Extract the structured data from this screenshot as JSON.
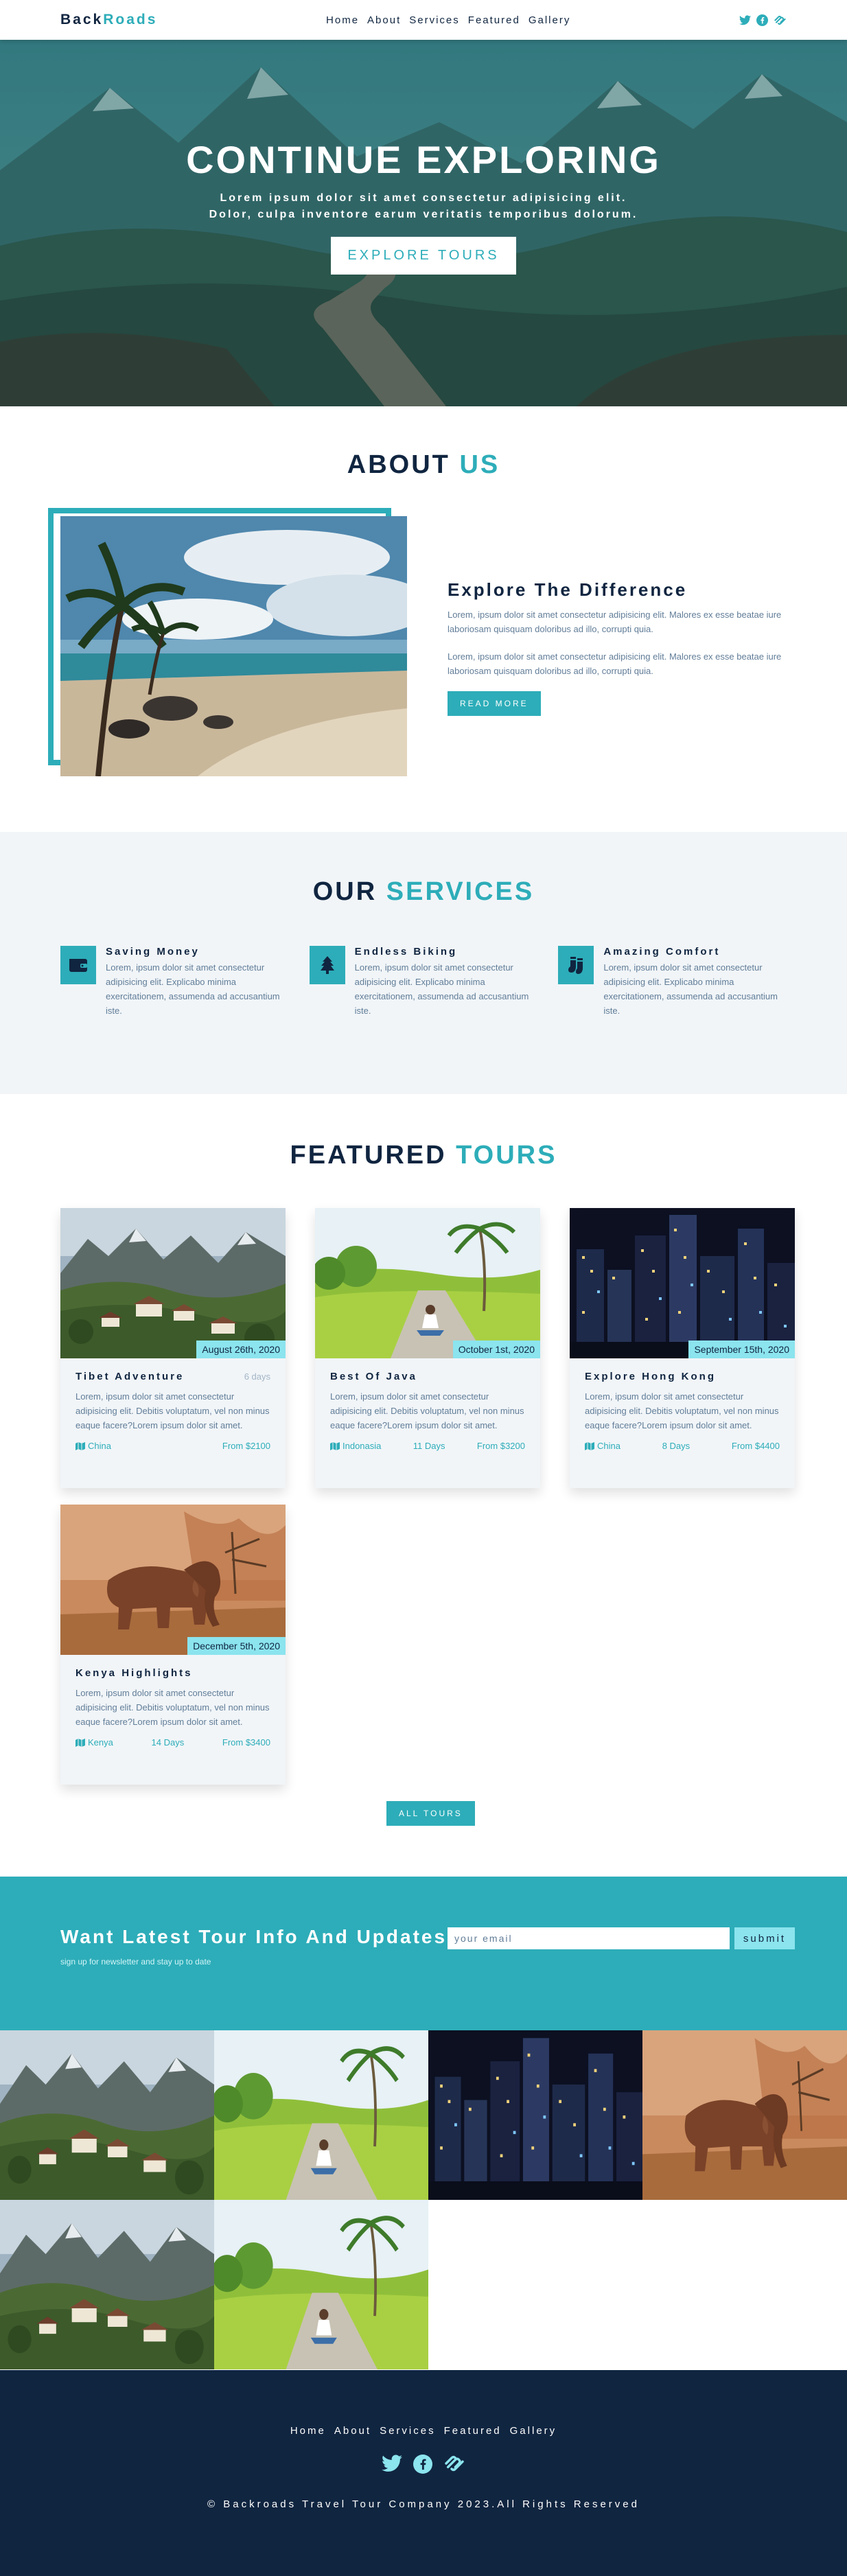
{
  "brand": {
    "part1": "Back",
    "part2": "Roads",
    "color_primary": "#2dadb9",
    "color_dark": "#102540",
    "color_light_teal": "#8be4ee",
    "color_grey_bg": "#f1f5f8"
  },
  "nav": {
    "links": [
      "Home",
      "About",
      "Services",
      "Featured",
      "Gallery"
    ],
    "social_icons": [
      "twitter-icon",
      "facebook-icon",
      "squarespace-icon"
    ]
  },
  "hero": {
    "title": "CONTINUE EXPLORING",
    "text": "Lorem ipsum dolor sit amet consectetur adipisicing elit. Dolor, culpa inventore earum veritatis temporibus dolorum.",
    "button": "EXPLORE TOURS"
  },
  "about": {
    "title_main": "ABOUT",
    "title_accent": "US",
    "heading": "Explore The Difference",
    "paragraphs": [
      "Lorem, ipsum dolor sit amet consectetur adipisicing elit. Malores ex esse beatae iure laboriosam quisquam doloribus ad illo, corrupti quia.",
      "Lorem, ipsum dolor sit amet consectetur adipisicing elit. Malores ex esse beatae iure laboriosam quisquam doloribus ad illo, corrupti quia."
    ],
    "button": "READ MORE"
  },
  "services": {
    "title_main": "OUR",
    "title_accent": "SERVICES",
    "items": [
      {
        "icon": "wallet-icon",
        "title": "Saving Money",
        "text": "Lorem, ipsum dolor sit amet consectetur adipisicing elit. Explicabo minima exercitationem, assumenda ad accusantium iste."
      },
      {
        "icon": "tree-icon",
        "title": "Endless Biking",
        "text": "Lorem, ipsum dolor sit amet consectetur adipisicing elit. Explicabo minima exercitationem, assumenda ad accusantium iste."
      },
      {
        "icon": "socks-icon",
        "title": "Amazing Comfort",
        "text": "Lorem, ipsum dolor sit amet consectetur adipisicing elit. Explicabo minima exercitationem, assumenda ad accusantium iste."
      }
    ]
  },
  "tours": {
    "title_main": "FEATURED",
    "title_accent": "TOURS",
    "items": [
      {
        "date": "August 26th, 2020",
        "name": "Tibet Adventure",
        "duration_top": "6 days",
        "text": "Lorem, ipsum dolor sit amet consectetur adipisicing elit. Debitis voluptatum, vel non minus eaque facere?Lorem ipsum dolor sit amet.",
        "country": "China",
        "duration": "",
        "price": "From $2100"
      },
      {
        "date": "October 1st, 2020",
        "name": "Best Of Java",
        "duration_top": "",
        "text": "Lorem, ipsum dolor sit amet consectetur adipisicing elit. Debitis voluptatum, vel non minus eaque facere?Lorem ipsum dolor sit amet.",
        "country": "Indonasia",
        "duration": "11 Days",
        "price": "From $3200"
      },
      {
        "date": "September 15th, 2020",
        "name": "Explore Hong Kong",
        "duration_top": "",
        "text": "Lorem, ipsum dolor sit amet consectetur adipisicing elit. Debitis voluptatum, vel non minus eaque facere?Lorem ipsum dolor sit amet.",
        "country": "China",
        "duration": "8 Days",
        "price": "From $4400"
      },
      {
        "date": "December 5th, 2020",
        "name": "Kenya Highlights",
        "duration_top": "",
        "text": "Lorem, ipsum dolor sit amet consectetur adipisicing elit. Debitis voluptatum, vel non minus eaque facere?Lorem ipsum dolor sit amet.",
        "country": "Kenya",
        "duration": "14 Days",
        "price": "From $3400"
      }
    ],
    "button": "ALL TOURS"
  },
  "newsletter": {
    "title": "Want Latest Tour Info And Updates?",
    "subtitle": "sign up for newsletter and stay up to date",
    "placeholder": "your email",
    "button": "submit"
  },
  "gallery": {
    "images": [
      "mountain-village",
      "java-road",
      "city-night",
      "elephant",
      "mountain-village",
      "java-road"
    ]
  },
  "footer": {
    "links": [
      "Home",
      "About",
      "Services",
      "Featured",
      "Gallery"
    ],
    "copyright": "© Backroads Travel Tour Company 2023.All Rights Reserved"
  }
}
